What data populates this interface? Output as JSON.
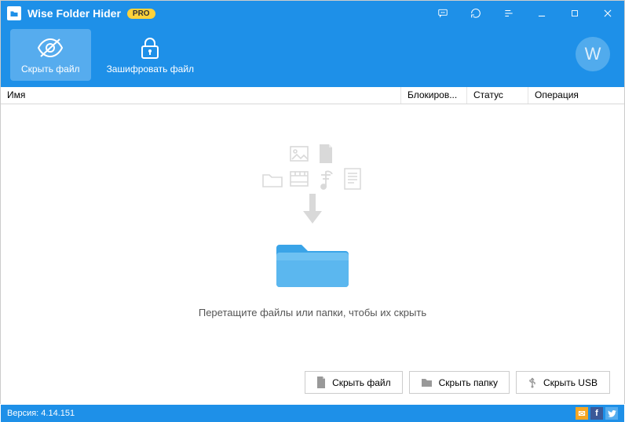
{
  "titlebar": {
    "app_title": "Wise Folder Hider",
    "pro_badge": "PRO"
  },
  "toolbar": {
    "hide_file_label": "Скрыть файл",
    "encrypt_file_label": "Зашифровать файл"
  },
  "user_avatar_letter": "W",
  "columns": {
    "name": "Имя",
    "lock": "Блокиров...",
    "status": "Статус",
    "operation": "Операция"
  },
  "main": {
    "drop_hint": "Перетащите файлы или папки, чтобы их скрыть"
  },
  "actions": {
    "hide_file": "Скрыть файл",
    "hide_folder": "Скрыть папку",
    "hide_usb": "Скрыть USB"
  },
  "statusbar": {
    "version": "Версия: 4.14.151"
  },
  "colors": {
    "primary": "#1e90e8",
    "pro_badge_bg": "#ffd23a"
  }
}
